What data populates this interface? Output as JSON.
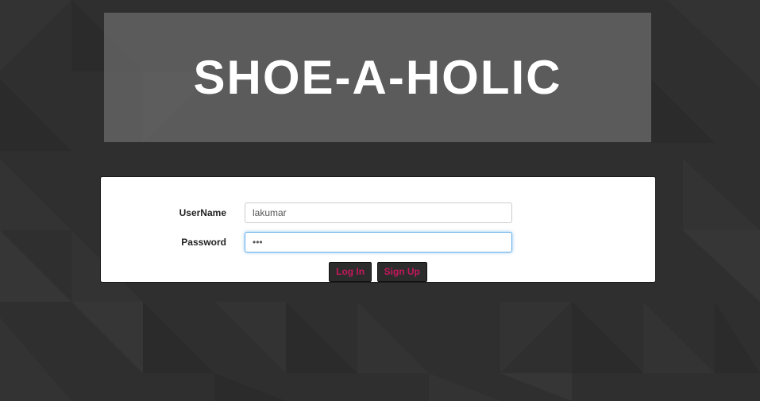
{
  "banner": {
    "title": "SHOE-A-HOLIC"
  },
  "login_form": {
    "username_label": "UserName",
    "username_value": "lakumar",
    "password_label": "Password",
    "password_value": "•••",
    "login_button_label": "Log In",
    "signup_button_label": "Sign Up"
  },
  "colors": {
    "background": "#2e2e2e",
    "banner_overlay": "#5c5c5c",
    "button_bg": "#2c2c2c",
    "button_text": "#c2185b",
    "focus_border": "#66afe9"
  }
}
